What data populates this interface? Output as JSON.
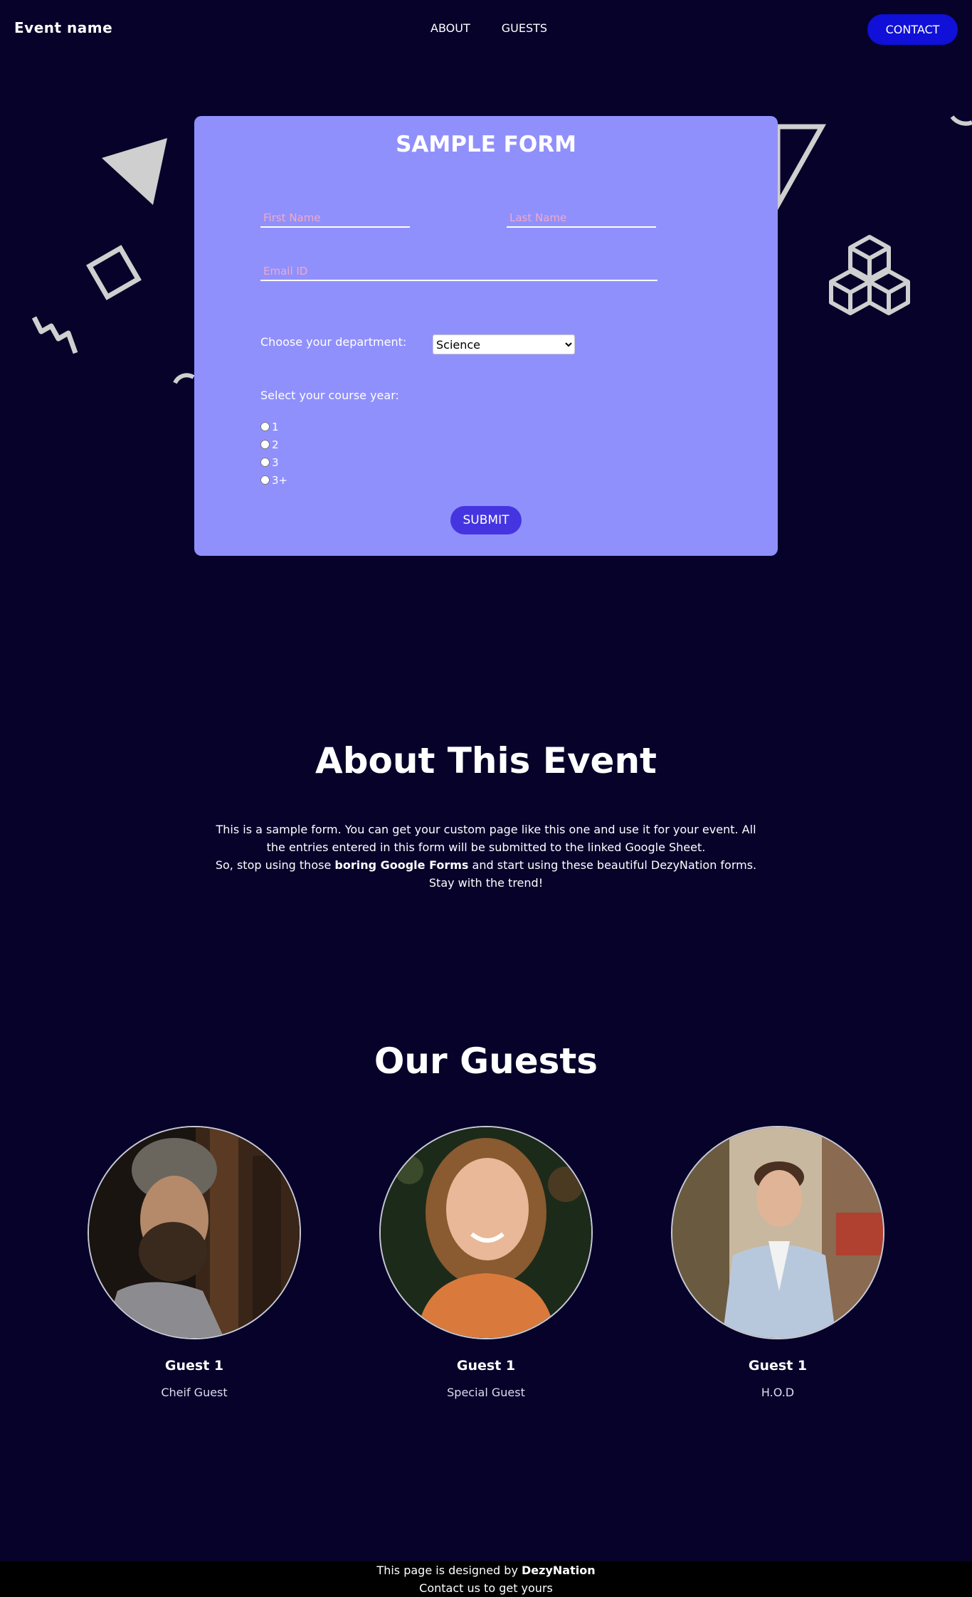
{
  "nav": {
    "brand": "Event name",
    "links": [
      "ABOUT",
      "GUESTS"
    ],
    "contact_label": "CONTACT"
  },
  "form": {
    "title": "SAMPLE FORM",
    "first_name_placeholder": "First Name",
    "last_name_placeholder": "Last Name",
    "email_placeholder": "Email ID",
    "department_label": "Choose your department:",
    "department_selected": "Science",
    "course_year_label": "Select your course year:",
    "course_years": [
      "1",
      "2",
      "3",
      "3+"
    ],
    "submit_label": "SUBMIT"
  },
  "about": {
    "title": "About This Event",
    "line1": "This is a sample form. You can get your custom page like this one and use it for your event. All the entries entered in this form will be submitted to the linked Google Sheet.",
    "line2_start": "So, stop using those ",
    "line2_bold": "boring Google Forms",
    "line2_end": " and start using these beautiful DezyNation forms.",
    "line3": "Stay with the trend!"
  },
  "guests": {
    "title": "Our Guests",
    "items": [
      {
        "name": "Guest 1",
        "role": "Cheif Guest"
      },
      {
        "name": "Guest 1",
        "role": "Special Guest"
      },
      {
        "name": "Guest 1",
        "role": "H.O.D"
      }
    ]
  },
  "footer": {
    "line1_start": "This page is designed by ",
    "line1_brand": "DezyNation",
    "line2": "Contact us to get yours"
  },
  "colors": {
    "background": "#06022a",
    "form_card": "#9090fc",
    "contact_button": "#1010d8",
    "submit_button": "#4535e0",
    "placeholder": "#f2a8c8"
  }
}
